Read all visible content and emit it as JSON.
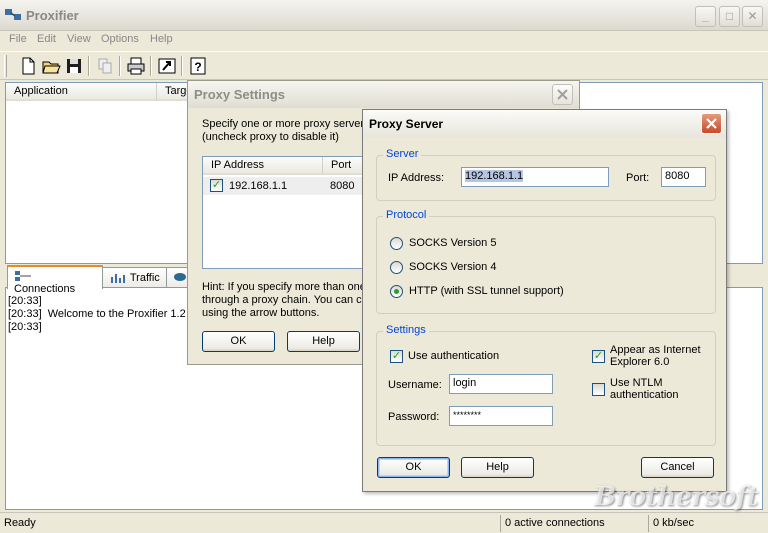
{
  "main": {
    "title": "Proxifier",
    "menu": [
      "File",
      "Edit",
      "View",
      "Options",
      "Help"
    ],
    "columns": [
      "Application",
      "Target"
    ],
    "tabs": [
      "Connections",
      "Traffic"
    ],
    "log": [
      "[20:33]",
      "[20:33]  Welcome to the Proxifier 1.2",
      "[20:33]"
    ],
    "status": {
      "left": "Ready",
      "connections": "0 active connections",
      "speed": "0 kb/sec"
    }
  },
  "proxy_settings": {
    "title": "Proxy Settings",
    "intro_line1": "Specify one or more proxy servers:",
    "intro_line2": "(uncheck proxy to disable it)",
    "col_ip": "IP Address",
    "col_port": "Port",
    "row_ip": "192.168.1.1",
    "row_port": "8080",
    "hint_line1": "Hint: If you specify more than one",
    "hint_line2": "through a proxy chain. You can ch",
    "hint_line3": "using the arrow buttons.",
    "ok": "OK",
    "help": "Help"
  },
  "proxy_server": {
    "title": "Proxy Server",
    "server_group": "Server",
    "ip_label": "IP Address:",
    "ip_value": "192.168.1.1",
    "port_label": "Port:",
    "port_value": "8080",
    "protocol_group": "Protocol",
    "socks5": "SOCKS Version 5",
    "socks4": "SOCKS Version 4",
    "http": "HTTP (with SSL tunnel support)",
    "selected_protocol": "http",
    "settings_group": "Settings",
    "use_auth": "Use authentication",
    "use_auth_checked": true,
    "appear_ie_line1": "Appear as Internet",
    "appear_ie_line2": "Explorer 6.0",
    "appear_ie_checked": true,
    "ntlm_line1": "Use NTLM",
    "ntlm_line2": "authentication",
    "ntlm_checked": false,
    "username_label": "Username:",
    "username_value": "login",
    "password_label": "Password:",
    "password_value": "********",
    "ok": "OK",
    "help": "Help",
    "cancel": "Cancel"
  },
  "watermark": "Brothersoft"
}
